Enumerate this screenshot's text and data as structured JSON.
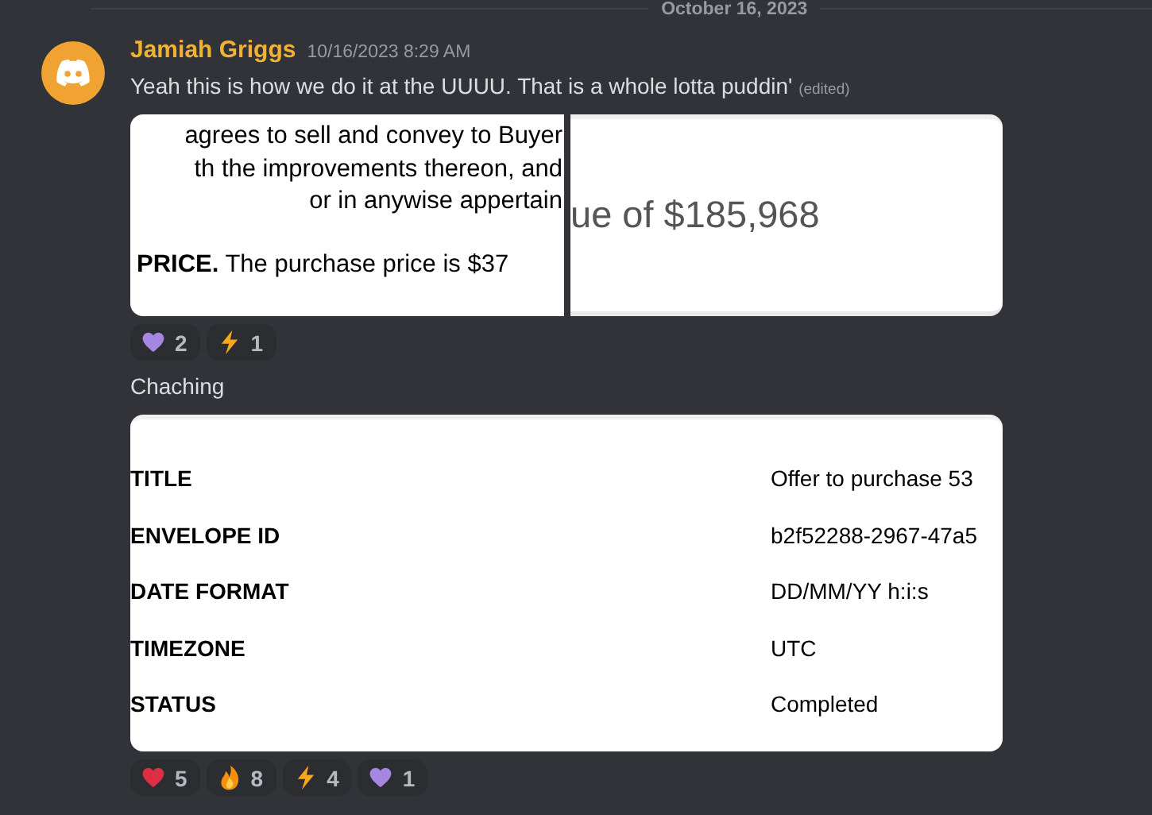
{
  "date_divider": "October 16, 2023",
  "message": {
    "author": "Jamiah Griggs",
    "timestamp": "10/16/2023 8:29 AM",
    "text": "Yeah this is how we do it at the UUUU. That is a whole lotta puddin'",
    "edited_tag": "(edited)",
    "attachments": [
      {
        "kind": "contract-excerpt",
        "lines": [
          "agrees to sell and convey to Buyer",
          "th the improvements thereon, and",
          "or in anywise appertain"
        ],
        "closing": "**PRICE.** The purchase price is $37"
      },
      {
        "kind": "value-crop",
        "text": "ue of $185,968"
      }
    ],
    "reactions": [
      {
        "kind": "heart",
        "color": "#a586e0",
        "count": "2"
      },
      {
        "kind": "bolt",
        "color": "#f4a81d",
        "count": "1"
      }
    ]
  },
  "followup": {
    "text": "Chaching",
    "document": {
      "rows": [
        {
          "label": "TITLE",
          "value": "Offer to purchase 53"
        },
        {
          "label": "ENVELOPE ID",
          "value": "b2f52288-2967-47a5"
        },
        {
          "label": "DATE FORMAT",
          "value": "DD/MM/YY h:i:s"
        },
        {
          "label": "TIMEZONE",
          "value": "UTC"
        },
        {
          "label": "STATUS",
          "value": "Completed"
        }
      ]
    },
    "reactions": [
      {
        "kind": "heart",
        "color": "#dd2e44",
        "count": "5"
      },
      {
        "kind": "fire",
        "color": "#f4900c",
        "count": "8"
      },
      {
        "kind": "bolt",
        "color": "#f4a81d",
        "count": "4"
      },
      {
        "kind": "heart",
        "color": "#a586e0",
        "count": "1"
      }
    ]
  }
}
